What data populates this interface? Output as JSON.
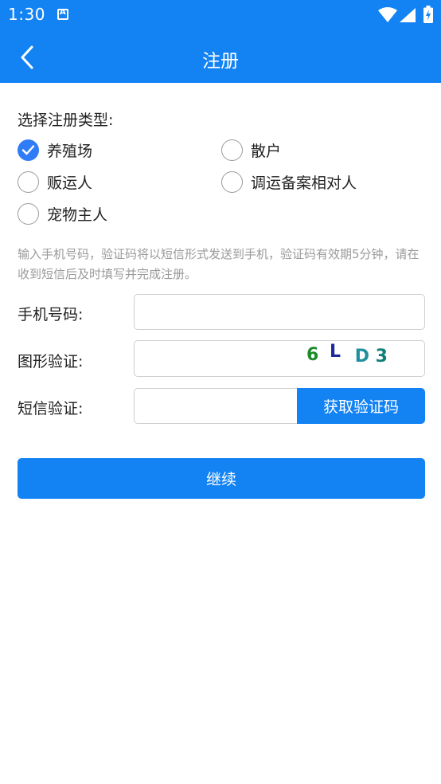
{
  "status_bar": {
    "time": "1:30",
    "icons": [
      "notification-a-icon",
      "wifi-icon",
      "cell-signal-icon",
      "battery-charging-icon"
    ]
  },
  "app_bar": {
    "title": "注册",
    "back_icon": "chevron-left-icon"
  },
  "registration_type": {
    "title": "选择注册类型:",
    "options": [
      {
        "label": "养殖场",
        "checked": true
      },
      {
        "label": "散户",
        "checked": false
      },
      {
        "label": "贩运人",
        "checked": false
      },
      {
        "label": "调运备案相对人",
        "checked": false
      },
      {
        "label": "宠物主人",
        "checked": false
      }
    ]
  },
  "hint": "输入手机号码，验证码将以短信形式发送到手机，验证码有效期5分钟，请在收到短信后及时填写并完成注册。",
  "form": {
    "phone_label": "手机号码:",
    "phone_value": "",
    "captcha_label": "图形验证:",
    "captcha_value": "",
    "captcha_chars": [
      {
        "char": "6",
        "color": "#1b8a2a"
      },
      {
        "char": "L",
        "color": "#1d2a9a"
      },
      {
        "char": "D",
        "color": "#1f8fa0"
      },
      {
        "char": "3",
        "color": "#0f8078"
      }
    ],
    "sms_label": "短信验证:",
    "sms_value": "",
    "sms_button": "获取验证码"
  },
  "continue_button": "继续",
  "colors": {
    "primary": "#1383f4",
    "radio_checked": "#2f7cf6",
    "hint_text": "#9a9a9a",
    "border": "#cfcfcf"
  }
}
